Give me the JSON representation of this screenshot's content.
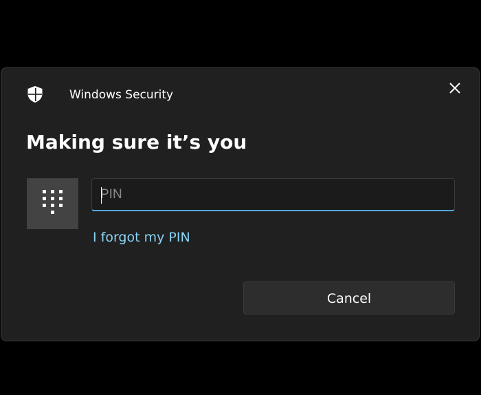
{
  "window": {
    "title": "Windows Security",
    "icon": "shield-icon",
    "close_icon": "close-icon"
  },
  "main": {
    "heading": "Making sure it’s you",
    "pin_tile_icon": "keypad-icon",
    "pin_input": {
      "value": "",
      "placeholder": "PIN"
    },
    "forgot_link": "I forgot my PIN",
    "cancel_label": "Cancel"
  },
  "colors": {
    "background": "#000000",
    "dialog": "#202020",
    "tile": "#434343",
    "accent": "#52a8da",
    "link": "#8ad4f5"
  }
}
